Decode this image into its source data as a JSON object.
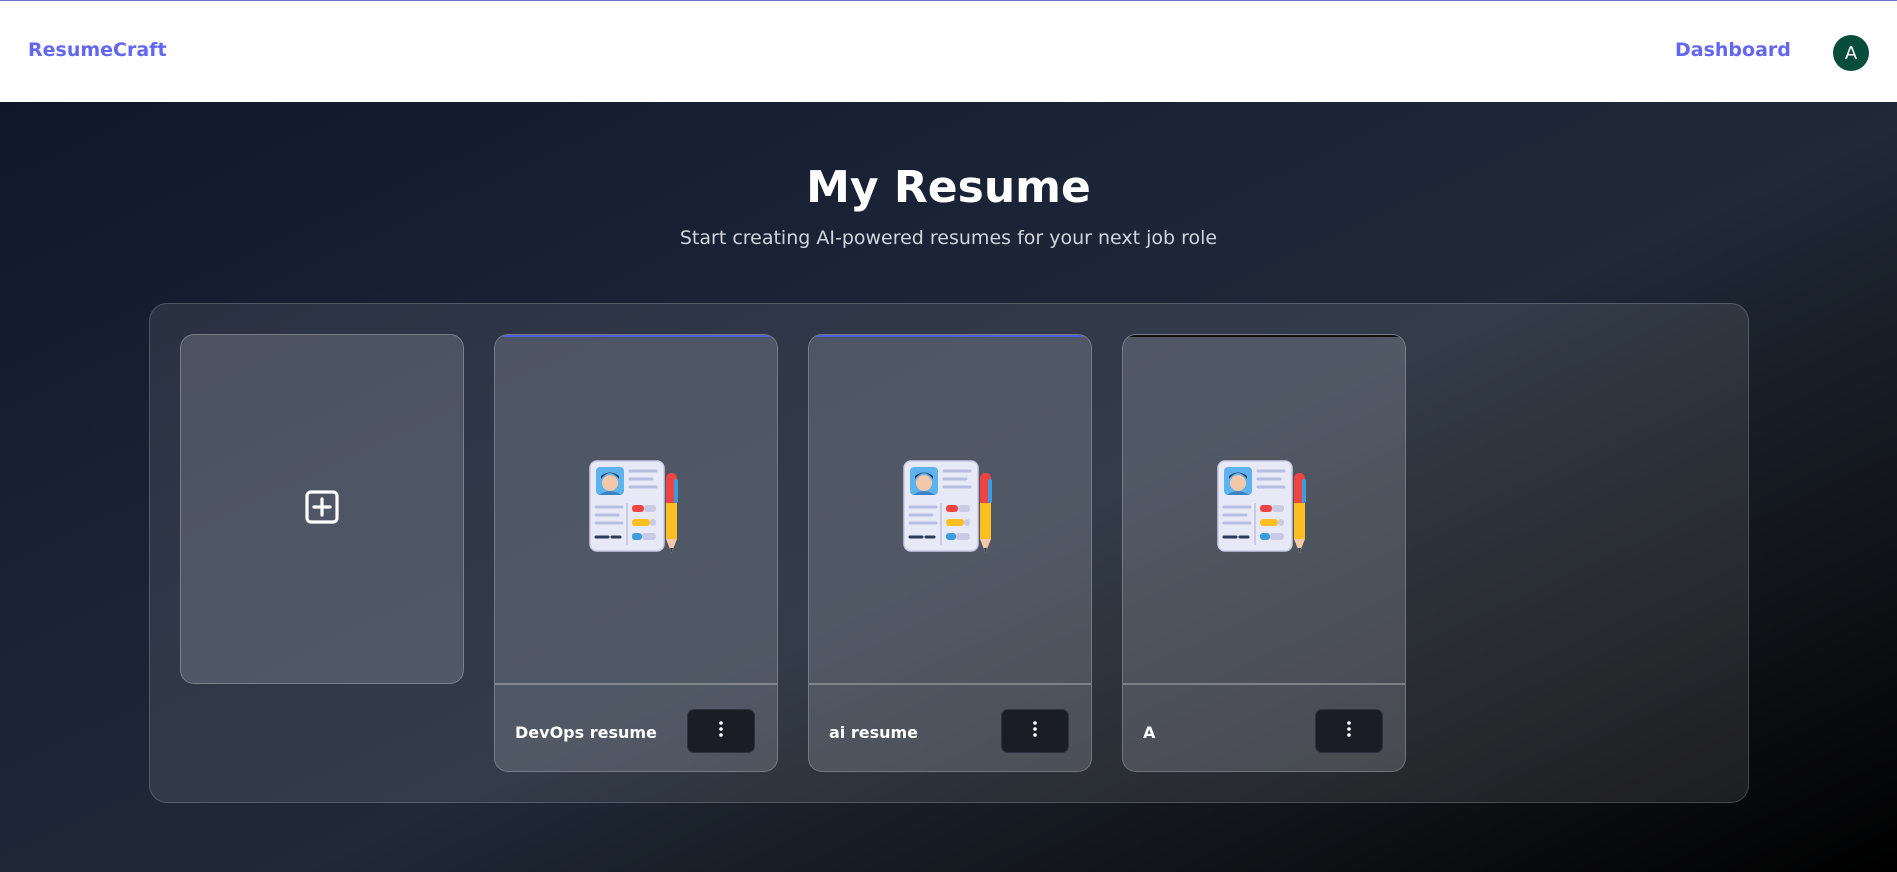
{
  "header": {
    "brand": "ResumeCraft",
    "nav_dashboard": "Dashboard",
    "avatar_initial": "A",
    "avatar_color": "#064e3b",
    "accent_color": "#6366f1"
  },
  "main": {
    "title": "My Resume",
    "subtitle": "Start creating AI-powered resumes for your next job role",
    "add_card_icon": "plus-square-icon",
    "resumes": [
      {
        "name": "DevOps resume",
        "accent": "#4f5fd8",
        "icon": "resume-with-pen-icon",
        "menu_icon": "more-vertical-icon"
      },
      {
        "name": "ai resume",
        "accent": "#4f5fd8",
        "icon": "resume-with-pen-icon",
        "menu_icon": "more-vertical-icon"
      },
      {
        "name": "A",
        "accent": "#111111",
        "icon": "resume-with-pen-icon",
        "menu_icon": "more-vertical-icon"
      }
    ]
  }
}
